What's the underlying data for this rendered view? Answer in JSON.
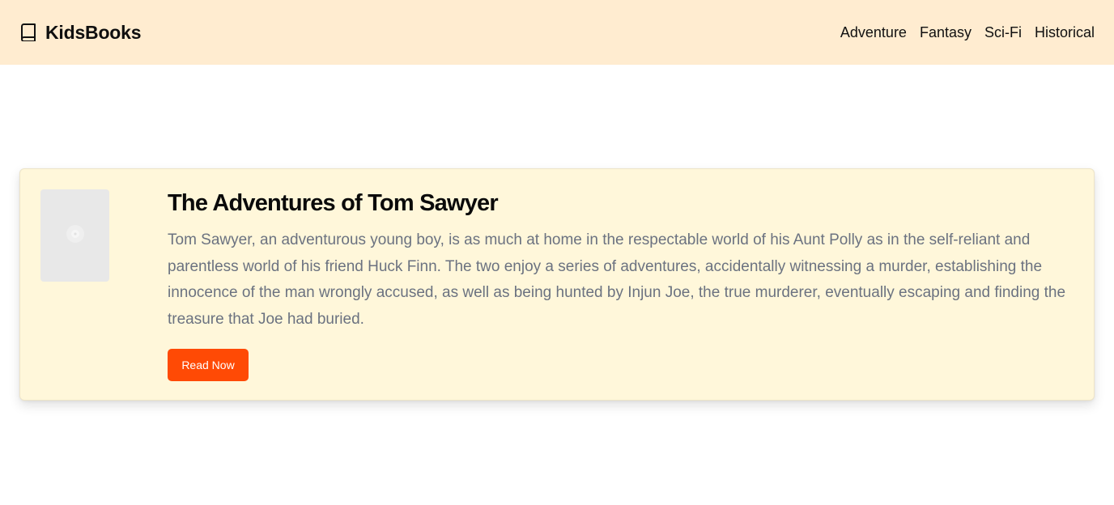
{
  "header": {
    "brand_icon": "book-icon",
    "brand_name": "KidsBooks",
    "nav": [
      {
        "label": "Adventure"
      },
      {
        "label": "Fantasy"
      },
      {
        "label": "Sci-Fi"
      },
      {
        "label": "Historical"
      }
    ]
  },
  "book": {
    "cover_icon": "image-placeholder-icon",
    "title": "The Adventures of Tom Sawyer",
    "description": "Tom Sawyer, an adventurous young boy, is as much at home in the respectable world of his Aunt Polly as in the self-reliant and parentless world of his friend Huck Finn. The two enjoy a series of adventures, accidentally witnessing a murder, establishing the innocence of the man wrongly accused, as well as being hunted by Injun Joe, the true murderer, eventually escaping and finding the treasure that Joe had buried.",
    "button_label": "Read Now"
  },
  "colors": {
    "header_bg": "#ffecd0",
    "card_bg": "#fff7da",
    "button_bg": "#ff4a05",
    "description_text": "#6b7280"
  }
}
